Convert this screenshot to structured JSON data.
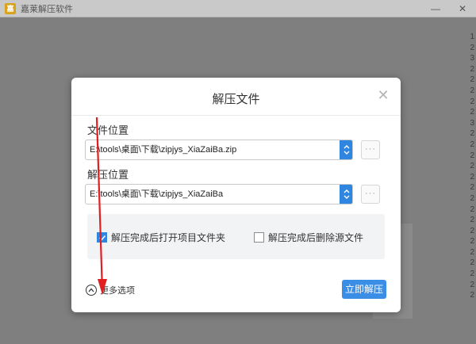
{
  "app": {
    "title": "嘉莱解压软件",
    "logo_glyph": "嘉",
    "minimize": "—",
    "close": "✕"
  },
  "side_digits": [
    "1",
    "2",
    "3",
    "2",
    "2",
    "2",
    "2",
    "2",
    "3",
    "2",
    "2",
    "2",
    "2",
    "2",
    "2",
    "2",
    "2",
    "2",
    "2",
    "2",
    "2",
    "2",
    "2",
    "2",
    "2"
  ],
  "dialog": {
    "title": "解压文件",
    "close_glyph": "✕",
    "source_label": "文件位置",
    "source_path": "E:\\tools\\桌面\\下载\\zipjys_XiaZaiBa.zip",
    "dest_label": "解压位置",
    "dest_path": "E:\\tools\\桌面\\下载\\zipjys_XiaZaiBa",
    "browse_glyph": "···",
    "options": {
      "open_folder": {
        "label": "解压完成后打开项目文件夹",
        "checked": true
      },
      "delete_source": {
        "label": "解压完成后删除源文件",
        "checked": false
      }
    },
    "more_options_label": "更多选项",
    "extract_button": "立即解压"
  },
  "colors": {
    "accent": "#2f86e0",
    "annotation": "#e02020"
  }
}
